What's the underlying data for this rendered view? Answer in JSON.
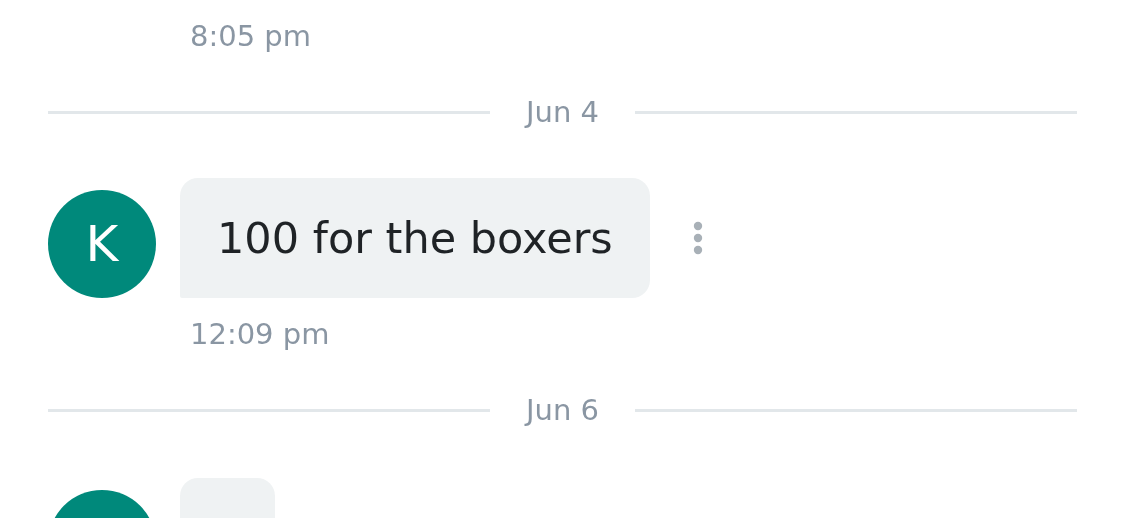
{
  "feed": [
    {
      "kind": "time",
      "text": "8:05 pm"
    },
    {
      "kind": "date",
      "text": "Jun 4"
    },
    {
      "kind": "message",
      "avatar": "K",
      "text": "100 for the boxers"
    },
    {
      "kind": "time",
      "text": "12:09 pm"
    },
    {
      "kind": "date",
      "text": "Jun 6"
    },
    {
      "kind": "partial"
    }
  ]
}
